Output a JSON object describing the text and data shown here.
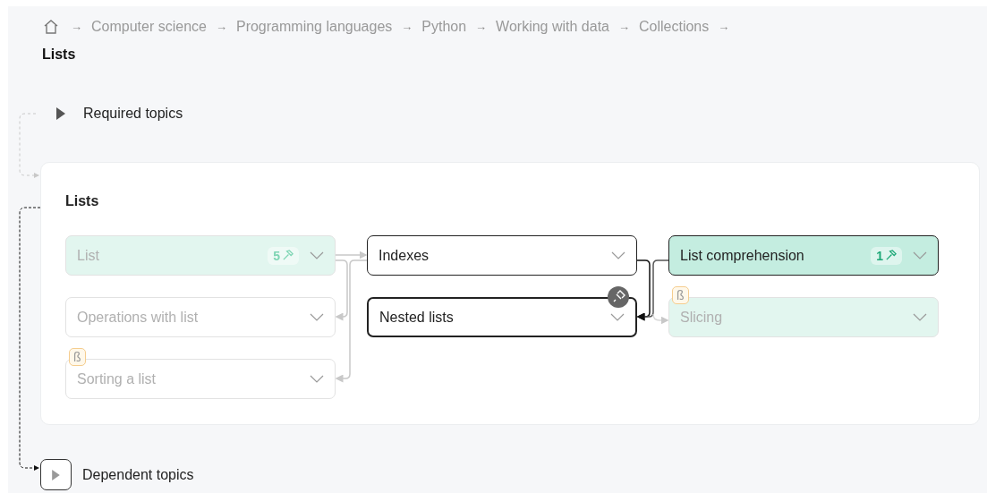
{
  "breadcrumb": [
    {
      "label": "Computer science",
      "arrow": "→",
      "current": false
    },
    {
      "label": "Programming languages",
      "arrow": "→",
      "current": false
    },
    {
      "label": "Python",
      "arrow": "→",
      "current": false
    },
    {
      "label": "Working with data",
      "arrow": "→",
      "current": false
    },
    {
      "label": "Collections",
      "arrow": "→",
      "current": false
    },
    {
      "label": "Lists",
      "arrow": "→",
      "current": true
    }
  ],
  "required_topics": {
    "label": "Required topics",
    "expanded": false
  },
  "topic_panel": {
    "title": "Lists",
    "columns": [
      [
        {
          "title": "List",
          "completed": true,
          "dimmed": true,
          "selected": false,
          "count": "5"
        },
        {
          "title": "Operations with list",
          "completed": false,
          "dimmed": true,
          "selected": false
        },
        {
          "title": "Sorting a list",
          "completed": false,
          "dimmed": true,
          "selected": false,
          "beta": "ß"
        }
      ],
      [
        {
          "title": "Indexes",
          "completed": false,
          "dimmed": false,
          "selected": false
        },
        {
          "title": "Nested lists",
          "completed": false,
          "dimmed": false,
          "selected": true
        }
      ],
      [
        {
          "title": "List comprehension",
          "completed": true,
          "dimmed": false,
          "selected": false,
          "count": "1"
        },
        {
          "title": "Slicing",
          "completed": true,
          "dimmed": true,
          "selected": false,
          "beta": "ß"
        }
      ]
    ]
  },
  "dependent_topics": {
    "label": "Dependent topics",
    "expanded": false
  }
}
